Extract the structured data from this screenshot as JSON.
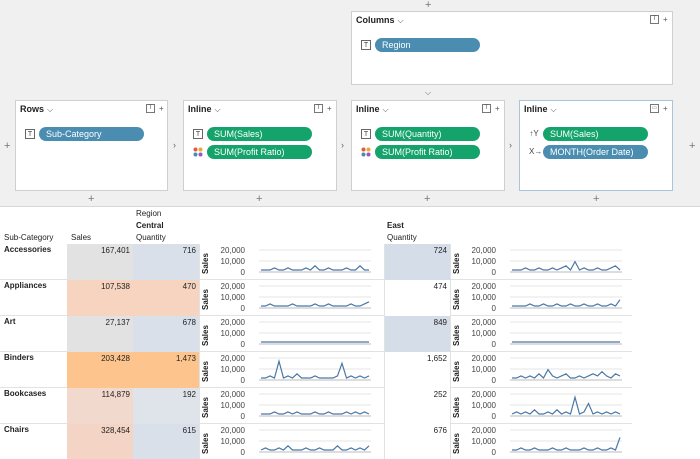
{
  "shelves": {
    "columns": {
      "title": "Columns",
      "pill": "Region"
    },
    "rows": {
      "title": "Rows",
      "pill": "Sub-Category"
    },
    "inline1": {
      "title": "Inline",
      "pills": [
        "SUM(Sales)",
        "SUM(Profit Ratio)"
      ]
    },
    "inline2": {
      "title": "Inline",
      "pills": [
        "SUM(Quantity)",
        "SUM(Profit Ratio)"
      ]
    },
    "inline3": {
      "title": "Inline",
      "pills": [
        "SUM(Sales)",
        "MONTH(Order Date)"
      ]
    }
  },
  "table": {
    "header": {
      "subcategory": "Sub-Category",
      "sales": "Sales",
      "region": "Region",
      "central": "Central",
      "quantity": "Quantity",
      "east": "East",
      "east_quantity": "Quantity"
    },
    "axis_title": "Sales",
    "ticks": [
      "20,000",
      "10,000",
      "0"
    ],
    "rows": [
      {
        "name": "Accessories",
        "sales": "167,401",
        "central_qty": "716",
        "east_qty": "724"
      },
      {
        "name": "Appliances",
        "sales": "107,538",
        "central_qty": "470",
        "east_qty": "474"
      },
      {
        "name": "Art",
        "sales": "27,137",
        "central_qty": "678",
        "east_qty": "849"
      },
      {
        "name": "Binders",
        "sales": "203,428",
        "central_qty": "1,473",
        "east_qty": "1,652"
      },
      {
        "name": "Bookcases",
        "sales": "114,879",
        "central_qty": "192",
        "east_qty": "252"
      },
      {
        "name": "Chairs",
        "sales": "328,454",
        "central_qty": "615",
        "east_qty": "676"
      }
    ]
  },
  "colors": {
    "sales_bg": [
      "#e2e2e2",
      "#f6d4bf",
      "#e2e2e2",
      "#fdc58d",
      "#f2d9cd",
      "#f4d4c4"
    ],
    "central_bg": [
      "#d9e0ea",
      "#f6d4bf",
      "#d9e0ea",
      "#fdc58d",
      "#dfe3ea",
      "#d9e0ea"
    ],
    "east_bg": [
      "#d5dde9",
      "#ffffff",
      "#d5dde9",
      "#ffffff",
      "#ffffff",
      "#ffffff"
    ],
    "line": "#4a78a6",
    "pill_blue": "#4a8db0",
    "pill_green": "#15a36c"
  }
}
